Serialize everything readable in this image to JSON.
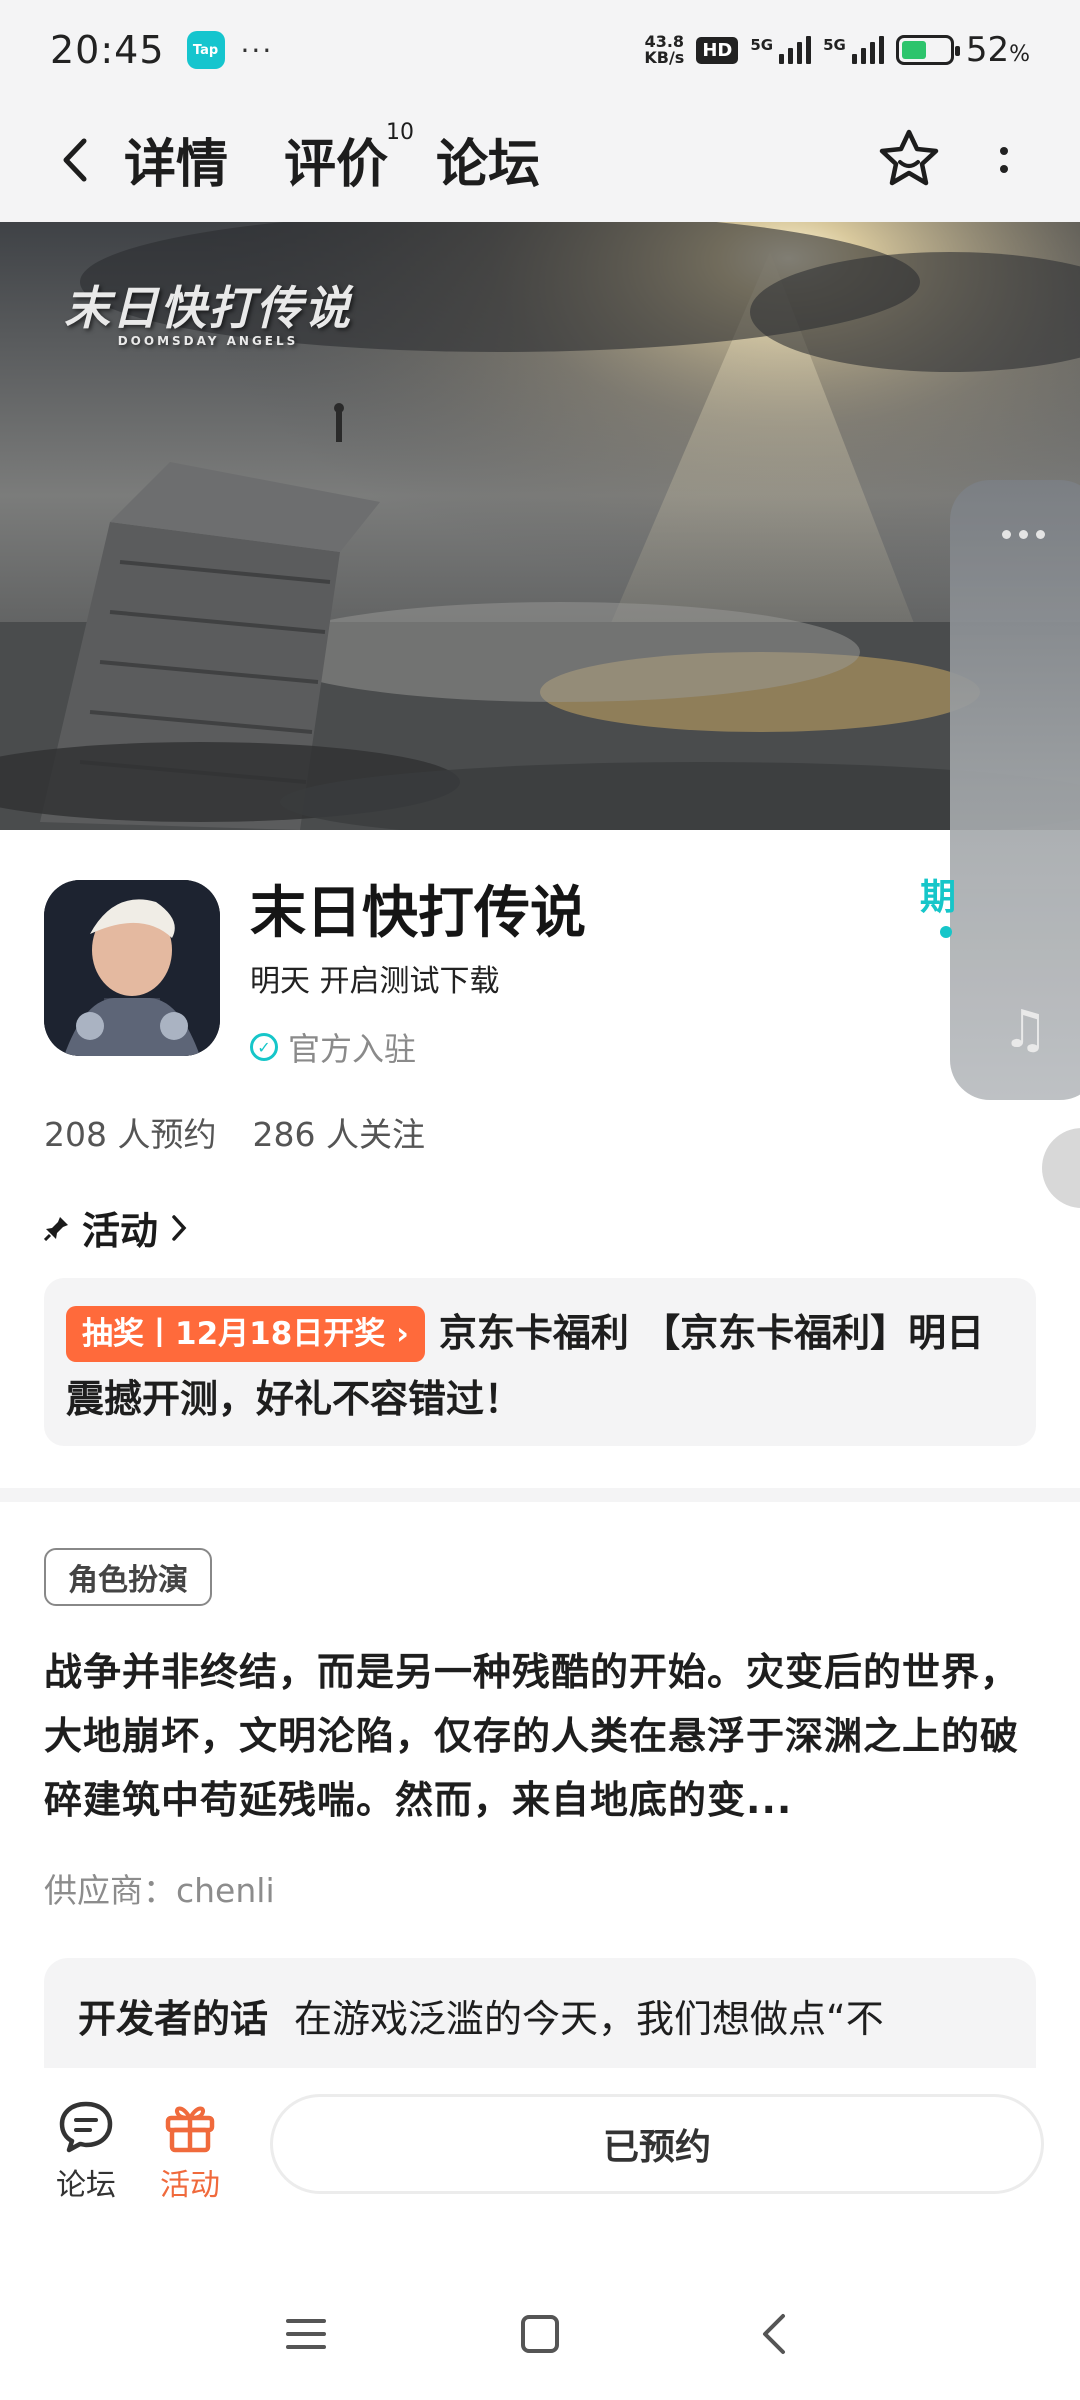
{
  "status_bar": {
    "time": "20:45",
    "app_badge": "Tap",
    "more": "···",
    "net_speed_value": "43.8",
    "net_speed_unit": "KB/s",
    "hd": "HD",
    "net1": "5G",
    "net2": "5G",
    "battery_value": "52",
    "battery_unit": "%"
  },
  "header": {
    "tabs": [
      {
        "label": "详情",
        "active": true
      },
      {
        "label": "评价",
        "badge": "10"
      },
      {
        "label": "论坛"
      }
    ]
  },
  "banner": {
    "logo": "末日快打传说"
  },
  "game": {
    "title": "末日快打传说",
    "subtitle": "明天 开启测试下载",
    "official": "官方入驻",
    "partial_label": "期",
    "stats": {
      "reservations": "208 人预约",
      "followers": "286 人关注"
    }
  },
  "activity": {
    "title": "活动",
    "tag": "抽奖丨12月18日开奖",
    "text": "京东卡福利 【京东卡福利】明日震撼开测，好礼不容错过！"
  },
  "about": {
    "genre": "角色扮演",
    "description": "战争并非终结，而是另一种残酷的开始。灾变后的世界，大地崩坏，文明沦陷，仅存的人类在悬浮于深渊之上的破碎建筑中苟延残喘。然而，来自地底的变...",
    "supplier": "供应商：chenli",
    "dev_title": "开发者的话",
    "dev_text": "在游戏泛滥的今天，我们想做点“不"
  },
  "bottom": {
    "forum": "论坛",
    "activity": "活动",
    "reserved": "已预约"
  },
  "colors": {
    "accent": "#16c6c9",
    "orange": "#ff6a3b",
    "background_gray": "#f4f4f5"
  }
}
